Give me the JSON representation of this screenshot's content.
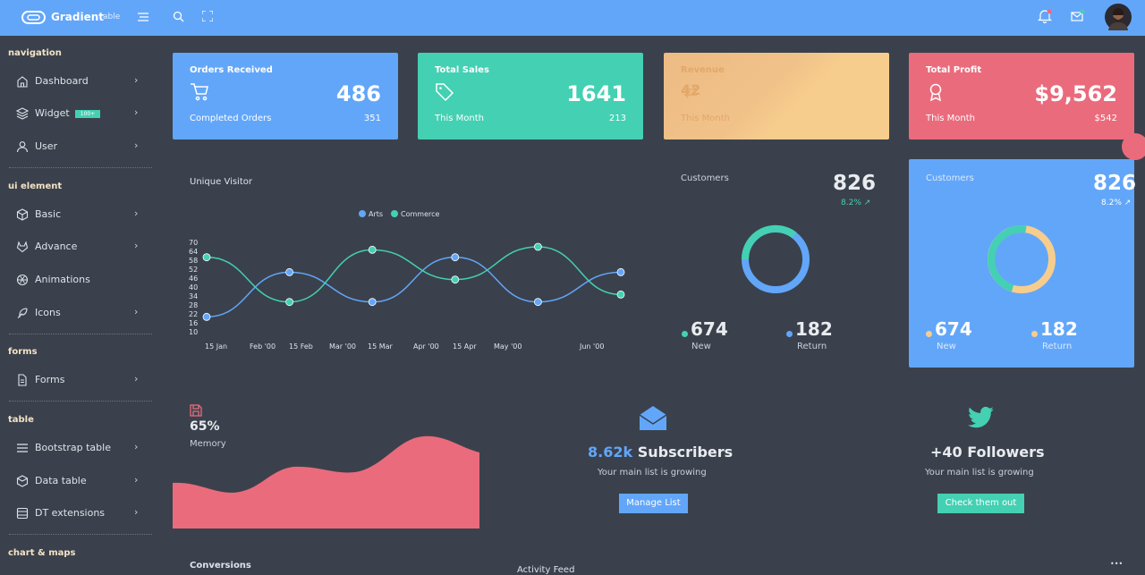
{
  "topbar": {
    "logo_text": "Gradient",
    "logo_suffix": "able"
  },
  "sidebar": {
    "sections": [
      {
        "title": "navigation"
      },
      {
        "title": "ui element"
      },
      {
        "title": "forms"
      },
      {
        "title": "table"
      },
      {
        "title": "chart & maps"
      }
    ],
    "items": [
      {
        "label": "Dashboard",
        "icon": "home-icon"
      },
      {
        "label": "Widget",
        "icon": "layers-icon",
        "badge": "100+"
      },
      {
        "label": "User",
        "icon": "user-icon"
      },
      {
        "label": "Basic",
        "icon": "box-icon"
      },
      {
        "label": "Advance",
        "icon": "gitlab-icon"
      },
      {
        "label": "Animations",
        "icon": "aperture-icon"
      },
      {
        "label": "Icons",
        "icon": "feather-icon"
      },
      {
        "label": "Forms",
        "icon": "file-text-icon"
      },
      {
        "label": "Bootstrap table",
        "icon": "server-icon"
      },
      {
        "label": "Data table",
        "icon": "database-icon"
      },
      {
        "label": "DT extensions",
        "icon": "file-plus-icon"
      }
    ]
  },
  "cards": [
    {
      "title": "Orders Received",
      "value": "486",
      "sub": "Completed Orders",
      "sub_value": "351",
      "color": "#62a6f9",
      "icon": "shopping-cart-icon"
    },
    {
      "title": "Total Sales",
      "value": "1641",
      "sub": "This Month",
      "sub_value": "213",
      "color": "#44d0b3",
      "icon": "tag-icon"
    },
    {
      "title": "Revenue",
      "value": "42",
      "sub": "This Month",
      "sub_value": "",
      "color": "#f7cd8d",
      "icon": "repeat-icon"
    },
    {
      "title": "Total Profit",
      "value": "$9,562",
      "sub": "This Month",
      "sub_value": "$542",
      "color": "#ea6b7c",
      "icon": "award-icon"
    }
  ],
  "unique_visitor": {
    "title": "Unique Visitor",
    "legend": [
      "Arts",
      "Commerce"
    ],
    "colors": {
      "arts": "#62a6f9",
      "commerce": "#44d0b3"
    }
  },
  "chart_data": {
    "type": "line",
    "title": "Unique Visitor",
    "x": [
      "2000-01-15",
      "2000-02-15",
      "2000-03-15",
      "2000-04-15",
      "2000-05-15",
      "2000-06-15"
    ],
    "x_tick_labels": [
      "15 Jan",
      "Feb '00",
      "15 Feb",
      "Mar '00",
      "15 Mar",
      "Apr '00",
      "15 Apr",
      "May '00",
      "Jun '00"
    ],
    "y_tick_labels": [
      "10",
      "16",
      "22",
      "28",
      "34",
      "40",
      "46",
      "52",
      "58",
      "64",
      "70"
    ],
    "ylim": [
      10,
      70
    ],
    "series": [
      {
        "name": "Arts",
        "values": [
          20,
          50,
          30,
          60,
          30,
          50
        ]
      },
      {
        "name": "Commerce",
        "values": [
          60,
          30,
          65,
          45,
          67,
          35
        ]
      }
    ],
    "legend_position": "top-center"
  },
  "customers_dark": {
    "title": "Customers",
    "value": "826",
    "change": "8.2%",
    "new_value": "674",
    "new_label": "New",
    "return_value": "182",
    "return_label": "Return"
  },
  "customers_blue": {
    "title": "Customers",
    "value": "826",
    "change": "8.2%",
    "new_value": "674",
    "new_label": "New",
    "return_value": "182",
    "return_label": "Return"
  },
  "memory": {
    "percent": "65%",
    "label": "Memory"
  },
  "subscribers": {
    "count": "8.62k",
    "label": "Subscribers",
    "sub": "Your main list is growing",
    "button": "Manage List"
  },
  "followers": {
    "title": "+40 Followers",
    "sub": "Your main list is growing",
    "button": "Check them out"
  },
  "bottom": {
    "conversions": "Conversions",
    "activity": "Activity Feed",
    "more": "•••"
  }
}
